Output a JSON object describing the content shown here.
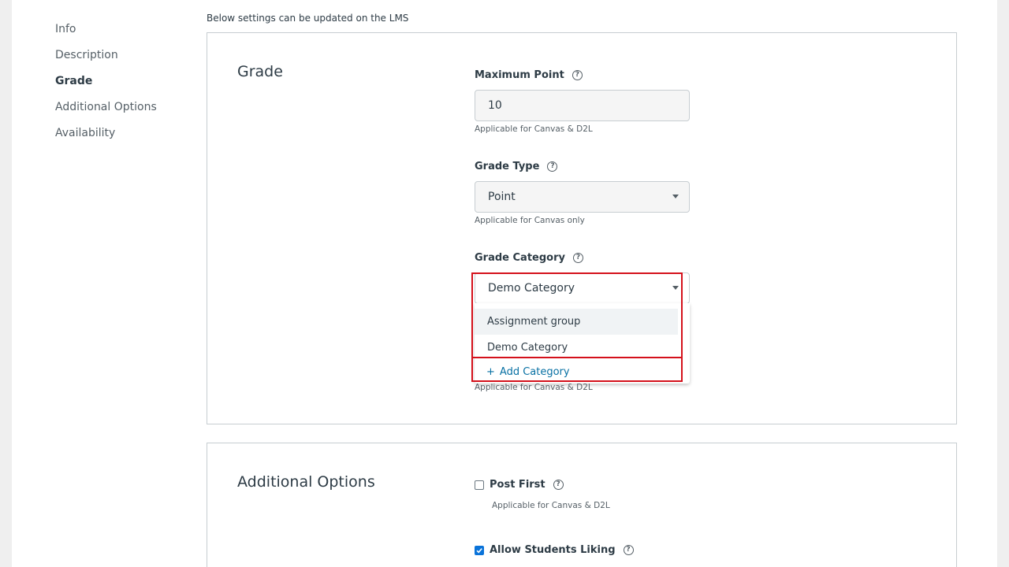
{
  "sidebar": {
    "items": [
      {
        "label": "Info",
        "active": false
      },
      {
        "label": "Description",
        "active": false
      },
      {
        "label": "Grade",
        "active": true
      },
      {
        "label": "Additional Options",
        "active": false
      },
      {
        "label": "Availability",
        "active": false
      }
    ]
  },
  "intro_text": "Below settings can be updated on the LMS",
  "grade": {
    "title": "Grade",
    "max_point": {
      "label": "Maximum Point",
      "value": "10",
      "hint": "Applicable for Canvas & D2L"
    },
    "grade_type": {
      "label": "Grade Type",
      "value": "Point",
      "hint": "Applicable for Canvas only"
    },
    "grade_category": {
      "label": "Grade Category",
      "value": "Demo Category",
      "options": [
        "Assignment group",
        "Demo Category"
      ],
      "add_label": "Add Category",
      "add_icon": "+",
      "hint": "Applicable for Canvas & D2L"
    }
  },
  "additional_options": {
    "title": "Additional Options",
    "post_first": {
      "label": "Post First",
      "checked": false,
      "hint": "Applicable for Canvas & D2L"
    },
    "allow_liking": {
      "label": "Allow Students Liking",
      "checked": true
    }
  },
  "icons": {
    "help": "question-circle-icon",
    "caret": "caret-down-icon",
    "check": "check-icon"
  },
  "colors": {
    "highlight": "#d4111b",
    "link": "#0770a3",
    "checkbox": "#0a73d9"
  }
}
